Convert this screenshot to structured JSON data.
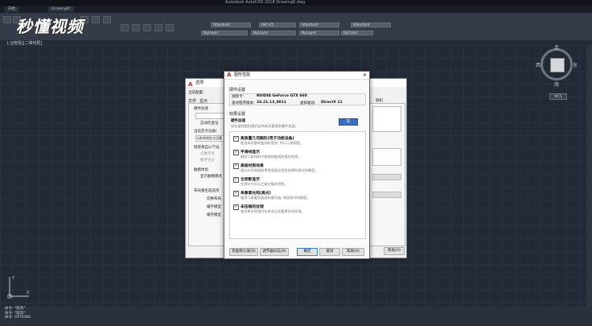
{
  "window": {
    "title": "Autodesk AutoCAD 2018   Drawing6.dwg"
  },
  "doc_tabs": [
    "开始",
    "Drawing6*"
  ],
  "ribbon": {
    "dropdowns": [
      "Standard",
      "ISO-25",
      "Standard",
      "Standard",
      "ByLayer",
      "ByLayer",
      "ByLayer",
      "ByColor"
    ]
  },
  "watermark": "秒懂视频",
  "viewport_label": "[-][俯视][二维线框]",
  "viewcube": {
    "north": "北",
    "south": "南",
    "east": "东",
    "west": "西",
    "top": "上",
    "wcs": "WCS"
  },
  "ucs": {
    "x": "X",
    "y": "Y"
  },
  "command_lines": [
    "命令: *取消*",
    "命令: *取消*",
    "命令: OPTIONS"
  ],
  "options_dialog": {
    "title": "选项",
    "profile_label": "当前配置:",
    "menu_tabs": [
      "文件",
      "显示",
      "打开和保存",
      "打印和发布",
      "系统",
      "用户系统配置",
      "绘图",
      "三维建模",
      "选择集",
      "配置",
      "联机"
    ],
    "left_texts": [
      "硬件加速",
      "自动检查证",
      "当前定点设备(",
      "当前系统定点设备",
      "接受来自以下设",
      "仅数字化",
      "数字化仪",
      "触摸体验",
      "显示触摸模式",
      "布局重生成选项",
      "切换布局",
      "缓存模型",
      "缓存模型"
    ],
    "help_button": "帮助(H)"
  },
  "gp_dialog": {
    "title": "图形性能",
    "hw_section": "硬件设置",
    "gpu_label": "视频卡:",
    "gpu_value": "NVIDIA GeForce GTX 660",
    "driver_label": "驱动程序版本:",
    "driver_value": "24.21.13_9811",
    "status_label": "虚拟驱动:",
    "status_value": "DirectX 11",
    "fx_section": "效果设置",
    "hw_accel_label": "硬件加速",
    "hw_accel_desc": "仅在请则图形模式支持本次要使用硬件加速。",
    "toggle": "开",
    "options": [
      {
        "name": "高质量几何图形(用于功能设备)",
        "desc": "使用高质量的曲线和直线, 并以二维视图。",
        "checked": "✓"
      },
      {
        "name": "平滑线显示",
        "desc": "删除二维线框中斜线和曲线的锯齿效果。",
        "checked": "✓"
      },
      {
        "name": "高级材质效果",
        "desc": "通过应用高级效果增强真实视觉效果的细节和精度。",
        "checked": "✓"
      },
      {
        "name": "全阴影显示",
        "desc": "在视口中显示三维对象的阴影。",
        "checked": "✓"
      },
      {
        "name": "单像素光照(高光)",
        "desc": "使用二维着色器面和着色器, 增加细节和精度。",
        "checked": "✓"
      },
      {
        "name": "未压缩的纹理",
        "desc": "使用更多视频内存来显示质量更好的纹理。",
        "checked": "✓"
      }
    ],
    "buttons": {
      "defaults": "恢复默认值(D)",
      "log": "调节器日志(D)",
      "ok": "确定",
      "cancel": "取消",
      "help": "帮助(H)"
    }
  }
}
